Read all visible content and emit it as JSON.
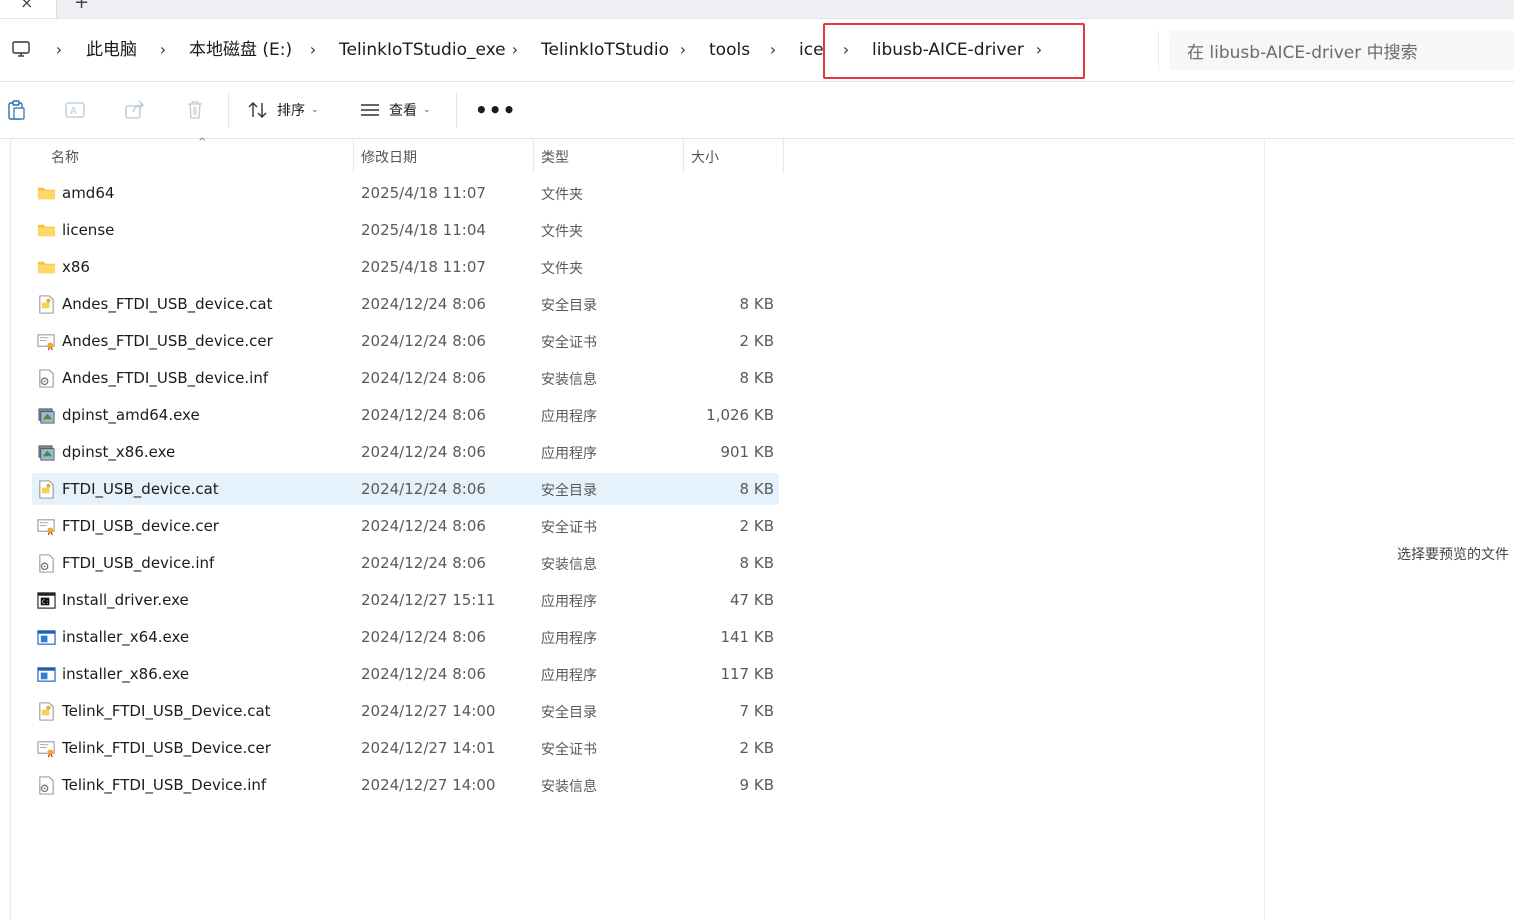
{
  "address": {
    "crumbs": [
      {
        "label": "此电脑"
      },
      {
        "label": "本地磁盘 (E:)"
      },
      {
        "label": "TelinkIoTStudio_exe"
      },
      {
        "label": "TelinkIoTStudio"
      },
      {
        "label": "tools"
      },
      {
        "label": "ice"
      },
      {
        "label": "libusb-AICE-driver"
      }
    ],
    "search_placeholder": "在 libusb-AICE-driver 中搜索"
  },
  "toolbar": {
    "sort_label": "排序",
    "view_label": "查看",
    "more_label": "•••"
  },
  "columns": {
    "name": "名称",
    "date": "修改日期",
    "type": "类型",
    "size": "大小"
  },
  "files": [
    {
      "name": "amd64",
      "date": "2025/4/18 11:07",
      "type": "文件夹",
      "size": "",
      "icon": "folder-icon",
      "selected": false
    },
    {
      "name": "license",
      "date": "2025/4/18 11:04",
      "type": "文件夹",
      "size": "",
      "icon": "folder-icon",
      "selected": false
    },
    {
      "name": "x86",
      "date": "2025/4/18 11:07",
      "type": "文件夹",
      "size": "",
      "icon": "folder-icon",
      "selected": false
    },
    {
      "name": "Andes_FTDI_USB_device.cat",
      "date": "2024/12/24 8:06",
      "type": "安全目录",
      "size": "8 KB",
      "icon": "catalog-file-icon",
      "selected": false
    },
    {
      "name": "Andes_FTDI_USB_device.cer",
      "date": "2024/12/24 8:06",
      "type": "安全证书",
      "size": "2 KB",
      "icon": "certificate-file-icon",
      "selected": false
    },
    {
      "name": "Andes_FTDI_USB_device.inf",
      "date": "2024/12/24 8:06",
      "type": "安装信息",
      "size": "8 KB",
      "icon": "setup-info-file-icon",
      "selected": false
    },
    {
      "name": "dpinst_amd64.exe",
      "date": "2024/12/24 8:06",
      "type": "应用程序",
      "size": "1,026 KB",
      "icon": "installer-app-icon",
      "selected": false
    },
    {
      "name": "dpinst_x86.exe",
      "date": "2024/12/24 8:06",
      "type": "应用程序",
      "size": "901 KB",
      "icon": "installer-app-icon",
      "selected": false
    },
    {
      "name": "FTDI_USB_device.cat",
      "date": "2024/12/24 8:06",
      "type": "安全目录",
      "size": "8 KB",
      "icon": "catalog-file-icon",
      "selected": true
    },
    {
      "name": "FTDI_USB_device.cer",
      "date": "2024/12/24 8:06",
      "type": "安全证书",
      "size": "2 KB",
      "icon": "certificate-file-icon",
      "selected": false
    },
    {
      "name": "FTDI_USB_device.inf",
      "date": "2024/12/24 8:06",
      "type": "安装信息",
      "size": "8 KB",
      "icon": "setup-info-file-icon",
      "selected": false
    },
    {
      "name": "Install_driver.exe",
      "date": "2024/12/27 15:11",
      "type": "应用程序",
      "size": "47 KB",
      "icon": "console-app-icon",
      "selected": false
    },
    {
      "name": "installer_x64.exe",
      "date": "2024/12/24 8:06",
      "type": "应用程序",
      "size": "141 KB",
      "icon": "window-app-icon",
      "selected": false
    },
    {
      "name": "installer_x86.exe",
      "date": "2024/12/24 8:06",
      "type": "应用程序",
      "size": "117 KB",
      "icon": "window-app-icon",
      "selected": false
    },
    {
      "name": "Telink_FTDI_USB_Device.cat",
      "date": "2024/12/27 14:00",
      "type": "安全目录",
      "size": "7 KB",
      "icon": "catalog-file-icon",
      "selected": false
    },
    {
      "name": "Telink_FTDI_USB_Device.cer",
      "date": "2024/12/27 14:01",
      "type": "安全证书",
      "size": "2 KB",
      "icon": "certificate-file-icon",
      "selected": false
    },
    {
      "name": "Telink_FTDI_USB_Device.inf",
      "date": "2024/12/27 14:00",
      "type": "安装信息",
      "size": "9 KB",
      "icon": "setup-info-file-icon",
      "selected": false
    }
  ],
  "preview": {
    "empty_text": "选择要预览的文件"
  },
  "colors": {
    "highlight": "#e0383e",
    "selected_row": "#e5f1fb",
    "folder": "#f5c242"
  }
}
